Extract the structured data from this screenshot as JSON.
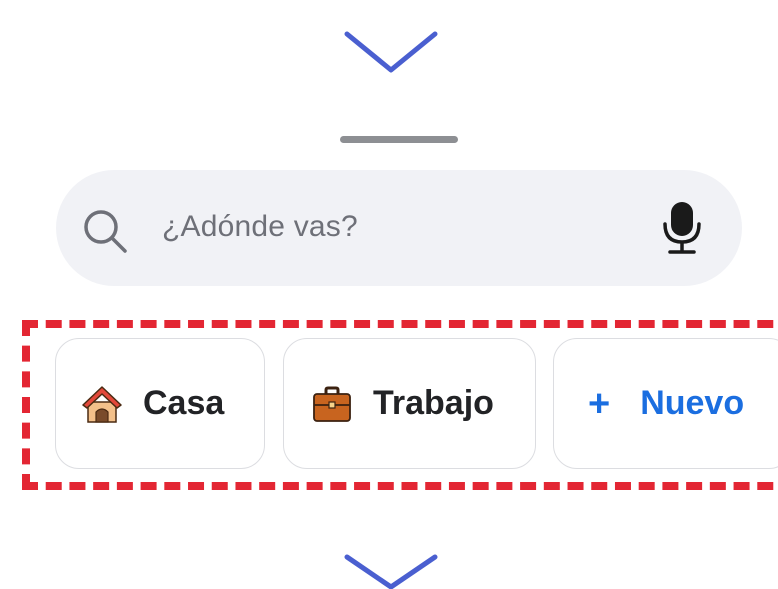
{
  "search": {
    "placeholder": "¿Adónde vas?",
    "search_icon": "search-icon",
    "mic_icon": "microphone-icon"
  },
  "shortcuts": [
    {
      "label": "Casa",
      "icon": "house-icon"
    },
    {
      "label": "Trabajo",
      "icon": "briefcase-icon"
    },
    {
      "label": "Nuevo",
      "icon": "plus-icon",
      "accent": "#1b6ee0"
    }
  ],
  "colors": {
    "highlight_border": "#e32633",
    "chevron": "#4a5fd0",
    "search_background": "#f1f2f6",
    "handle": "#8d8f93"
  },
  "decorations": {
    "top_arrow": "chevron-down-icon",
    "bottom_arrow": "chevron-down-icon"
  }
}
